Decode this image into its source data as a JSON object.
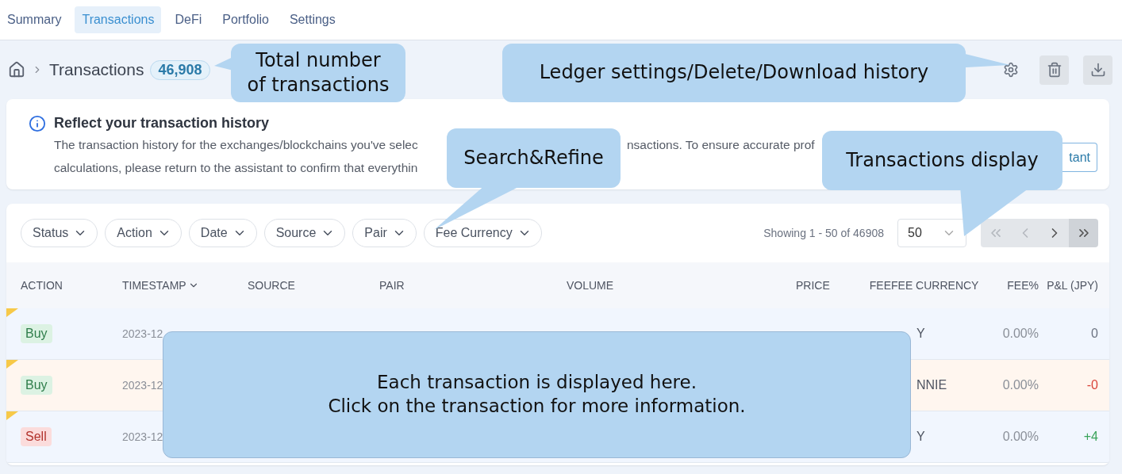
{
  "nav": {
    "tabs": [
      {
        "label": "Summary",
        "selected": false
      },
      {
        "label": "Transactions",
        "selected": true
      },
      {
        "label": "DeFi",
        "selected": false
      },
      {
        "label": "Portfolio",
        "selected": false
      },
      {
        "label": "Settings",
        "selected": false
      }
    ]
  },
  "breadcrumb": {
    "title": "Transactions",
    "count": "46,908"
  },
  "notice": {
    "title": "Reflect your transaction history",
    "line_1_start": "The transaction history for the exchanges/blockchains you've selec",
    "line_1_end": "nsactions. To ensure accurate prof",
    "line_2": "calculations, please return to the assistant to confirm that everythin",
    "button": "tant"
  },
  "filters": [
    "Status",
    "Action",
    "Date",
    "Source",
    "Pair",
    "Fee Currency"
  ],
  "pagination": {
    "summary": "Showing 1 - 50 of 46908",
    "page_size": "50"
  },
  "table": {
    "columns": [
      "ACTION",
      "TIMESTAMP",
      "SOURCE",
      "PAIR",
      "VOLUME",
      "PRICE",
      "FEE",
      "FEE CURRENCY",
      "FEE%",
      "P&L (JPY)"
    ],
    "rows": [
      {
        "action": "Buy",
        "kind": "buy",
        "timestamp": "2023-12",
        "fee_currency": "Y",
        "fee_pct": "0.00%",
        "pnl": "0",
        "color": "#6b7280",
        "flagged": false,
        "marked": true
      },
      {
        "action": "Buy",
        "kind": "buy",
        "timestamp": "2023-12",
        "fee_currency": "NNIE",
        "fee_pct": "0.00%",
        "pnl": "-0",
        "color": "#d9453a",
        "flagged": true,
        "marked": true
      },
      {
        "action": "Sell",
        "kind": "sell",
        "timestamp": "2023-12",
        "fee_currency": "Y",
        "fee_pct": "0.00%",
        "pnl": "+4",
        "color": "#3aa35a",
        "flagged": false,
        "marked": true
      }
    ]
  },
  "callouts": [
    {
      "text": "Total number\nof transactions"
    },
    {
      "text": "Ledger settings/Delete/Download history"
    },
    {
      "text": "Search&Refine"
    },
    {
      "text": "Transactions display"
    },
    {
      "text": "Each transaction is displayed here.\nClick on the transaction for more information."
    }
  ]
}
